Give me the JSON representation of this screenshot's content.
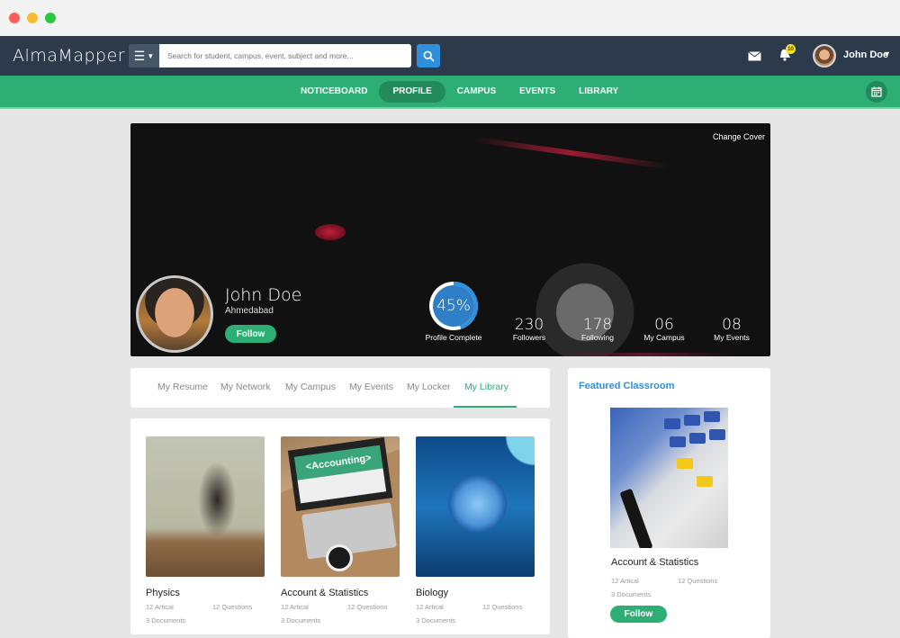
{
  "window": {
    "controls": [
      "close",
      "minimize",
      "maximize"
    ]
  },
  "topbar": {
    "logo": "AlmaMapper",
    "menu_icon": "hamburger-icon",
    "search": {
      "placeholder": "Search for student, campus, event, subject and more...",
      "value": ""
    },
    "notifications_count": "10",
    "user_name": "John Doe"
  },
  "nav": {
    "items": [
      {
        "label": "NOTICEBOARD",
        "active": false
      },
      {
        "label": "PROFILE",
        "active": true
      },
      {
        "label": "CAMPUS",
        "active": false
      },
      {
        "label": "EVENTS",
        "active": false
      },
      {
        "label": "LIBRARY",
        "active": false
      }
    ],
    "calendar_icon": "calendar-icon"
  },
  "profile": {
    "change_cover": "Change Cover",
    "name": "John Doe",
    "location": "Ahmedabad",
    "follow_label": "Follow",
    "completion_percent": 45,
    "completion_text": "45%",
    "completion_label": "Profile Complete",
    "stats": [
      {
        "value": "230",
        "label": "Followers"
      },
      {
        "value": "178",
        "label": "Following"
      },
      {
        "value": "06",
        "label": "My Campus"
      },
      {
        "value": "08",
        "label": "My Events"
      }
    ]
  },
  "tabs": [
    {
      "label": "My Resume",
      "active": false
    },
    {
      "label": "My Network",
      "active": false
    },
    {
      "label": "My Campus",
      "active": false
    },
    {
      "label": "My Events",
      "active": false
    },
    {
      "label": "My Locker",
      "active": false
    },
    {
      "label": "My Library",
      "active": true
    }
  ],
  "library": [
    {
      "title": "Physics",
      "articles": "12  Artical",
      "questions": "12  Questions",
      "documents": "3   Documents"
    },
    {
      "title": "Account & Statistics",
      "articles": "12  Artical",
      "questions": "12  Questions",
      "documents": "3   Documents",
      "image_text": "<Accounting>"
    },
    {
      "title": "Biology",
      "articles": "12  Artical",
      "questions": "12  Questions",
      "documents": "3   Documents"
    }
  ],
  "featured": {
    "heading": "Featured Classroom",
    "title": "Account & Statistics",
    "articles": "12  Artical",
    "questions": "12  Questions",
    "documents": "3   Documents",
    "follow_label": "Follow"
  },
  "colors": {
    "primary_green": "#2cae74",
    "dark_header": "#2c3a4b",
    "accent_blue": "#2f8fd8"
  }
}
